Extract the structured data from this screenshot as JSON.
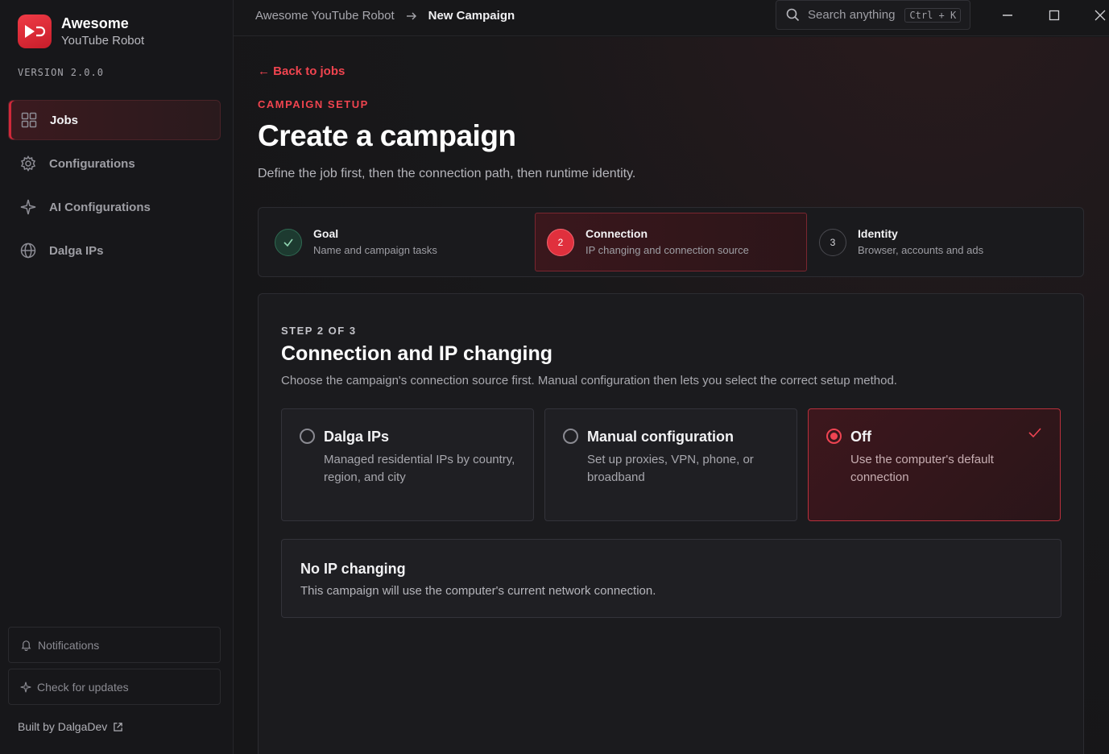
{
  "app": {
    "brand_title": "Awesome",
    "brand_subtitle": "YouTube Robot",
    "version": "VERSION 2.0.0",
    "accent_color": "#e8323f"
  },
  "sidebar": {
    "items": [
      {
        "label": "Jobs",
        "icon": "grid-icon",
        "active": true
      },
      {
        "label": "Configurations",
        "icon": "gear-icon",
        "active": false
      },
      {
        "label": "AI Configurations",
        "icon": "sparkle-icon",
        "active": false
      },
      {
        "label": "Dalga IPs",
        "icon": "globe-icon",
        "active": false
      }
    ],
    "notifications_label": "Notifications",
    "updates_label": "Check for updates",
    "built_by": "Built by DalgaDev"
  },
  "topbar": {
    "breadcrumb_root": "Awesome YouTube Robot",
    "breadcrumb_current": "New Campaign",
    "search_placeholder": "Search anything",
    "search_shortcut": "Ctrl + K"
  },
  "page": {
    "back_link": "← Back to jobs",
    "eyebrow": "CAMPAIGN SETUP",
    "title": "Create a campaign",
    "subtitle": "Define the job first, then the connection path, then runtime identity."
  },
  "steps": [
    {
      "number": "✓",
      "title": "Goal",
      "desc": "Name and campaign tasks",
      "state": "done"
    },
    {
      "number": "2",
      "title": "Connection",
      "desc": "IP changing and connection source",
      "state": "active"
    },
    {
      "number": "3",
      "title": "Identity",
      "desc": "Browser, accounts and ads",
      "state": "pending"
    }
  ],
  "panel": {
    "step_of": "STEP 2 OF 3",
    "title": "Connection and IP changing",
    "subtitle": "Choose the campaign's connection source first. Manual configuration then lets you select the correct setup method.",
    "options": [
      {
        "title": "Dalga IPs",
        "desc": "Managed residential IPs by country, region, and city",
        "selected": false
      },
      {
        "title": "Manual configuration",
        "desc": "Set up proxies, VPN, phone, or broadband",
        "selected": false
      },
      {
        "title": "Off",
        "desc": "Use the computer's default connection",
        "selected": true
      }
    ],
    "info_title": "No IP changing",
    "info_desc": "This campaign will use the computer's current network connection."
  }
}
